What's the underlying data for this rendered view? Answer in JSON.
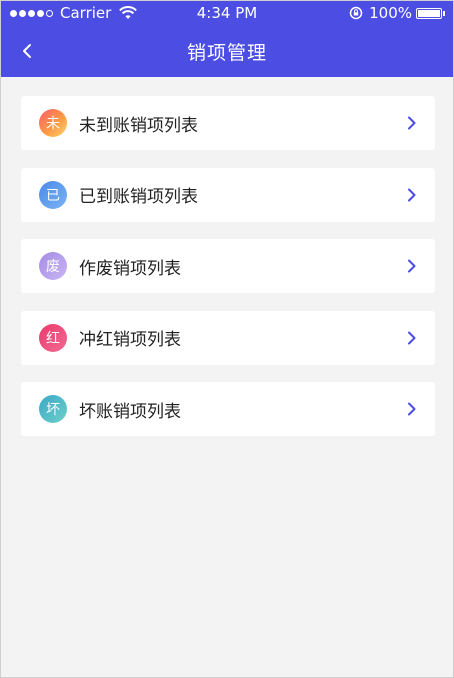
{
  "status_bar": {
    "carrier": "Carrier",
    "time": "4:34 PM",
    "battery": "100%"
  },
  "nav": {
    "title": "销项管理"
  },
  "colors": {
    "header": "#4b4de3",
    "chevron": "#4b4de3",
    "background": "#f3f3f3"
  },
  "items": [
    {
      "label": "未到账销项列表",
      "badge": "未",
      "icon": "unreceived-icon"
    },
    {
      "label": "已到账销项列表",
      "badge": "已",
      "icon": "received-icon"
    },
    {
      "label": "作废销项列表",
      "badge": "废",
      "icon": "voided-icon"
    },
    {
      "label": "冲红销项列表",
      "badge": "红",
      "icon": "red-reversal-icon"
    },
    {
      "label": "坏账销项列表",
      "badge": "坏",
      "icon": "bad-debt-icon"
    }
  ]
}
